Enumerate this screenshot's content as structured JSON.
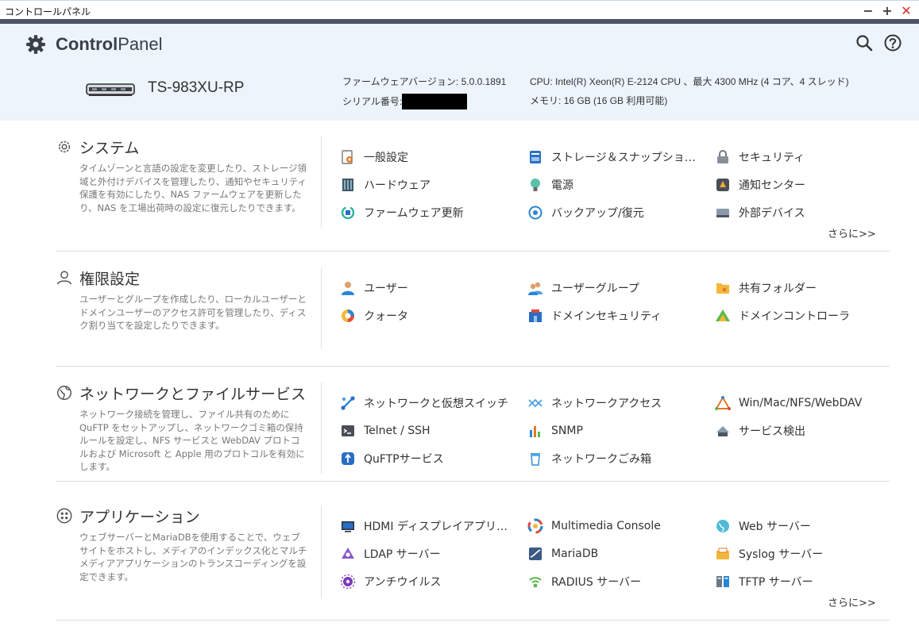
{
  "window": {
    "title": "コントロールパネル",
    "min": "−",
    "max": "+",
    "close": "✕"
  },
  "brand": {
    "bold": "Control",
    "light": "Panel"
  },
  "header_icons": [
    "search-icon",
    "help-icon"
  ],
  "device": {
    "model": "TS-983XU-RP",
    "firmware_label": "ファームウェアバージョン:",
    "firmware_value": "5.0.0.1891",
    "serial_label": "シリアル番号:",
    "cpu_label": "CPU:",
    "cpu_value": "Intel(R) Xeon(R) E-2124 CPU 、最大 4300 MHz (4 コア、4 スレッド)",
    "memory_label": "メモリ:",
    "memory_value": "16 GB (16 GB 利用可能)"
  },
  "sections": {
    "system": {
      "title": "システム",
      "desc": "タイムゾーンと言語の設定を変更したり、ストレージ領域と外付けデバイスを管理したり、通知やセキュリティ保護を有効にしたり、NAS ファームウェアを更新したり、NAS を工場出荷時の設定に復元したりできます。",
      "items": [
        "一般設定",
        "ストレージ＆スナップショット",
        "セキュリティ",
        "ハードウェア",
        "電源",
        "通知センター",
        "ファームウェア更新",
        "バックアップ/復元",
        "外部デバイス"
      ],
      "more": "さらに>>"
    },
    "privilege": {
      "title": "権限設定",
      "desc": "ユーザーとグループを作成したり、ローカルユーザーとドメインユーザーのアクセス許可を管理したり、ディスク割り当てを設定したりできます。",
      "items": [
        "ユーザー",
        "ユーザーグループ",
        "共有フォルダー",
        "クォータ",
        "ドメインセキュリティ",
        "ドメインコントローラ"
      ]
    },
    "network": {
      "title": "ネットワークとファイルサービス",
      "desc": "ネットワーク接続を管理し、ファイル共有のために QuFTP をセットアップし、ネットワークゴミ箱の保持ルールを設定し、NFS サービスと WebDAV プロトコルおよび Microsoft と Apple 用のプロトコルを有効にします。",
      "items": [
        "ネットワークと仮想スイッチ",
        "ネットワークアクセス",
        "Win/Mac/NFS/WebDAV",
        "Telnet / SSH",
        "SNMP",
        "サービス検出",
        "QuFTPサービス",
        "ネットワークごみ箱"
      ]
    },
    "apps": {
      "title": "アプリケーション",
      "desc": "ウェブサーバーとMariaDBを使用することで、ウェブサイトをホストし、メディアのインデックス化とマルチメディアアプリケーションのトランスコーディングを設定できます。",
      "items": [
        "HDMI ディスプレイアプリケーション",
        "Multimedia Console",
        "Web サーバー",
        "LDAP サーバー",
        "MariaDB",
        "Syslog サーバー",
        "アンチウイルス",
        "RADIUS サーバー",
        "TFTP サーバー"
      ],
      "more": "さらに>>"
    }
  },
  "colors": {
    "header_bg": "#edf4fc",
    "dark_bar": "#4c5163",
    "accent_blue": "#2a7fd4",
    "close_red": "#d42a2a"
  }
}
